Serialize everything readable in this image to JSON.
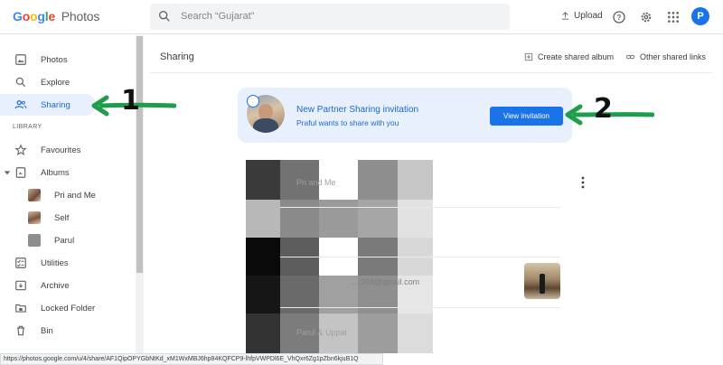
{
  "app": {
    "logo_google": "Google",
    "logo_product": "Photos"
  },
  "search": {
    "placeholder": "Search “Gujarat”"
  },
  "topbar": {
    "upload_label": "Upload",
    "avatar_letter": "P"
  },
  "sidebar": {
    "items": [
      {
        "label": "Photos",
        "icon": "photo-icon"
      },
      {
        "label": "Explore",
        "icon": "search-icon"
      },
      {
        "label": "Sharing",
        "icon": "people-icon",
        "active": true
      },
      {
        "label": "Favourites",
        "icon": "star-icon"
      },
      {
        "label": "Albums",
        "icon": "album-icon"
      },
      {
        "label": "Utilities",
        "icon": "checklist-icon"
      },
      {
        "label": "Archive",
        "icon": "archive-icon"
      },
      {
        "label": "Locked Folder",
        "icon": "lock-folder-icon"
      },
      {
        "label": "Bin",
        "icon": "trash-icon"
      }
    ],
    "section_library": "LIBRARY",
    "albums": [
      {
        "label": "Pri and Me"
      },
      {
        "label": "Self"
      },
      {
        "label": "Parul"
      }
    ]
  },
  "main": {
    "title": "Sharing",
    "create_shared_album": "Create shared album",
    "other_shared_links": "Other shared links",
    "invitation": {
      "title": "New Partner Sharing invitation",
      "subtitle": "Praful wants to share with you",
      "button": "View invitation"
    },
    "rows": [
      {
        "text": "Pri and Me"
      },
      {
        "text": "…304@gmail.com"
      },
      {
        "text": "Parul & Uppal"
      }
    ]
  },
  "annotations": {
    "step1": "1",
    "step2": "2",
    "arrow_color": "#1e9e4a"
  },
  "status_bar": {
    "url": "https://photos.google.com/u/4/share/AF1QipOPYGbNtKd_xM1WxMBJ6hp84KQFCP9-lhfpVWPDl6E_VhQxr6Zg1pZbn6kjuB1Q"
  },
  "colors": {
    "accent": "#1a73e8",
    "active_bg": "#e8f0fe",
    "card_bg": "#e8f0fe"
  }
}
